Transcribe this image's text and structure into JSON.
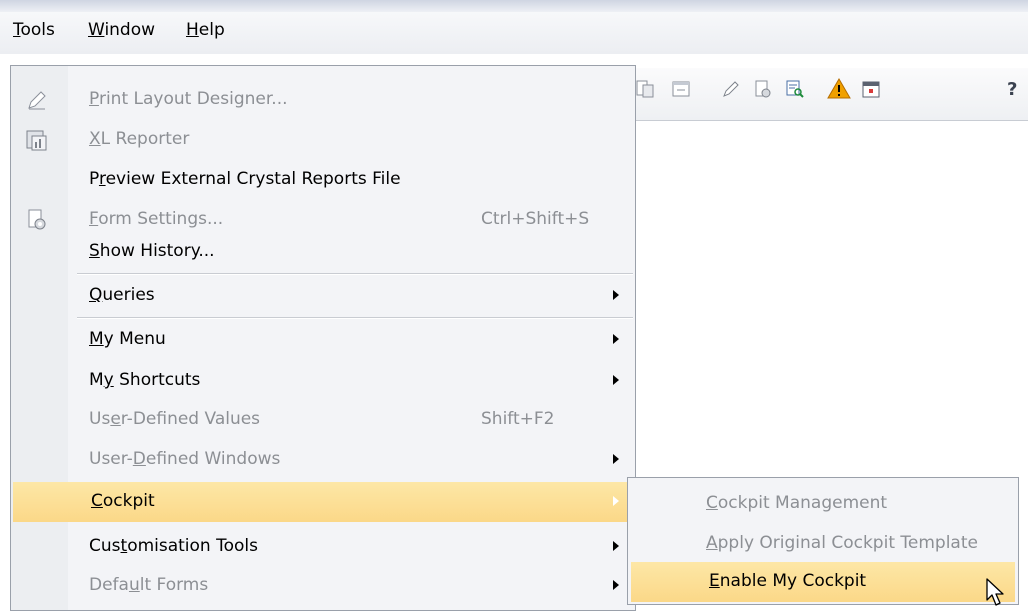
{
  "menubar": {
    "items": [
      {
        "label": "Tools",
        "mnemonic": "T"
      },
      {
        "label": "Window",
        "mnemonic": "W"
      },
      {
        "label": "Help",
        "mnemonic": "H"
      }
    ]
  },
  "tools_menu": {
    "items": [
      {
        "label": "Print Layout Designer...",
        "mnemonic_index": 0,
        "shortcut": "",
        "disabled": true,
        "submenu": false,
        "icon": "pencil-icon"
      },
      {
        "label": "XL Reporter",
        "mnemonic_index": 0,
        "shortcut": "",
        "disabled": true,
        "submenu": false,
        "icon": "xl-reporter-icon"
      },
      {
        "label": "Preview External Crystal Reports File",
        "mnemonic_index": 1,
        "shortcut": "",
        "disabled": false,
        "submenu": false,
        "icon": ""
      },
      {
        "label": "Form Settings...",
        "mnemonic_index": 0,
        "shortcut": "Ctrl+Shift+S",
        "disabled": true,
        "submenu": false,
        "icon": "form-settings-icon"
      },
      {
        "label": "Show History...",
        "mnemonic_index": 0,
        "shortcut": "",
        "disabled": false,
        "submenu": false,
        "icon": ""
      },
      {
        "label": "Queries",
        "mnemonic_index": 0,
        "shortcut": "",
        "disabled": false,
        "submenu": true,
        "icon": ""
      },
      {
        "label": "My Menu",
        "mnemonic_index": 0,
        "shortcut": "",
        "disabled": false,
        "submenu": true,
        "icon": ""
      },
      {
        "label": "My Shortcuts",
        "mnemonic_index": 1,
        "shortcut": "",
        "disabled": false,
        "submenu": true,
        "icon": ""
      },
      {
        "label": "User-Defined Values",
        "mnemonic_index": 2,
        "shortcut": "Shift+F2",
        "disabled": true,
        "submenu": false,
        "icon": ""
      },
      {
        "label": "User-Defined Windows",
        "mnemonic_index": 5,
        "shortcut": "",
        "disabled": true,
        "submenu": true,
        "icon": ""
      },
      {
        "label": "Cockpit",
        "mnemonic_index": 0,
        "shortcut": "",
        "disabled": false,
        "submenu": true,
        "highlighted": true,
        "icon": ""
      },
      {
        "label": "Customisation Tools",
        "mnemonic_index": 3,
        "shortcut": "",
        "disabled": false,
        "submenu": true,
        "icon": ""
      },
      {
        "label": "Default Forms",
        "mnemonic_index": 4,
        "shortcut": "",
        "disabled": true,
        "submenu": true,
        "icon": ""
      }
    ]
  },
  "cockpit_submenu": {
    "items": [
      {
        "label": "Cockpit Management",
        "mnemonic_index": 0,
        "disabled": true
      },
      {
        "label": "Apply Original Cockpit Template",
        "mnemonic_index": 0,
        "disabled": true
      },
      {
        "label": "Enable My Cockpit",
        "mnemonic_index": 0,
        "disabled": false,
        "highlighted": true
      }
    ]
  },
  "toolbar": {
    "icons": [
      "document-icon",
      "window-icon",
      "pencil-icon",
      "form-settings-icon",
      "search-report-icon",
      "alert-icon",
      "calendar-icon",
      "help-icon"
    ]
  },
  "colors": {
    "highlight": "#fbd888",
    "disabled_text": "#8c8f94",
    "alert": "#f0a000"
  }
}
